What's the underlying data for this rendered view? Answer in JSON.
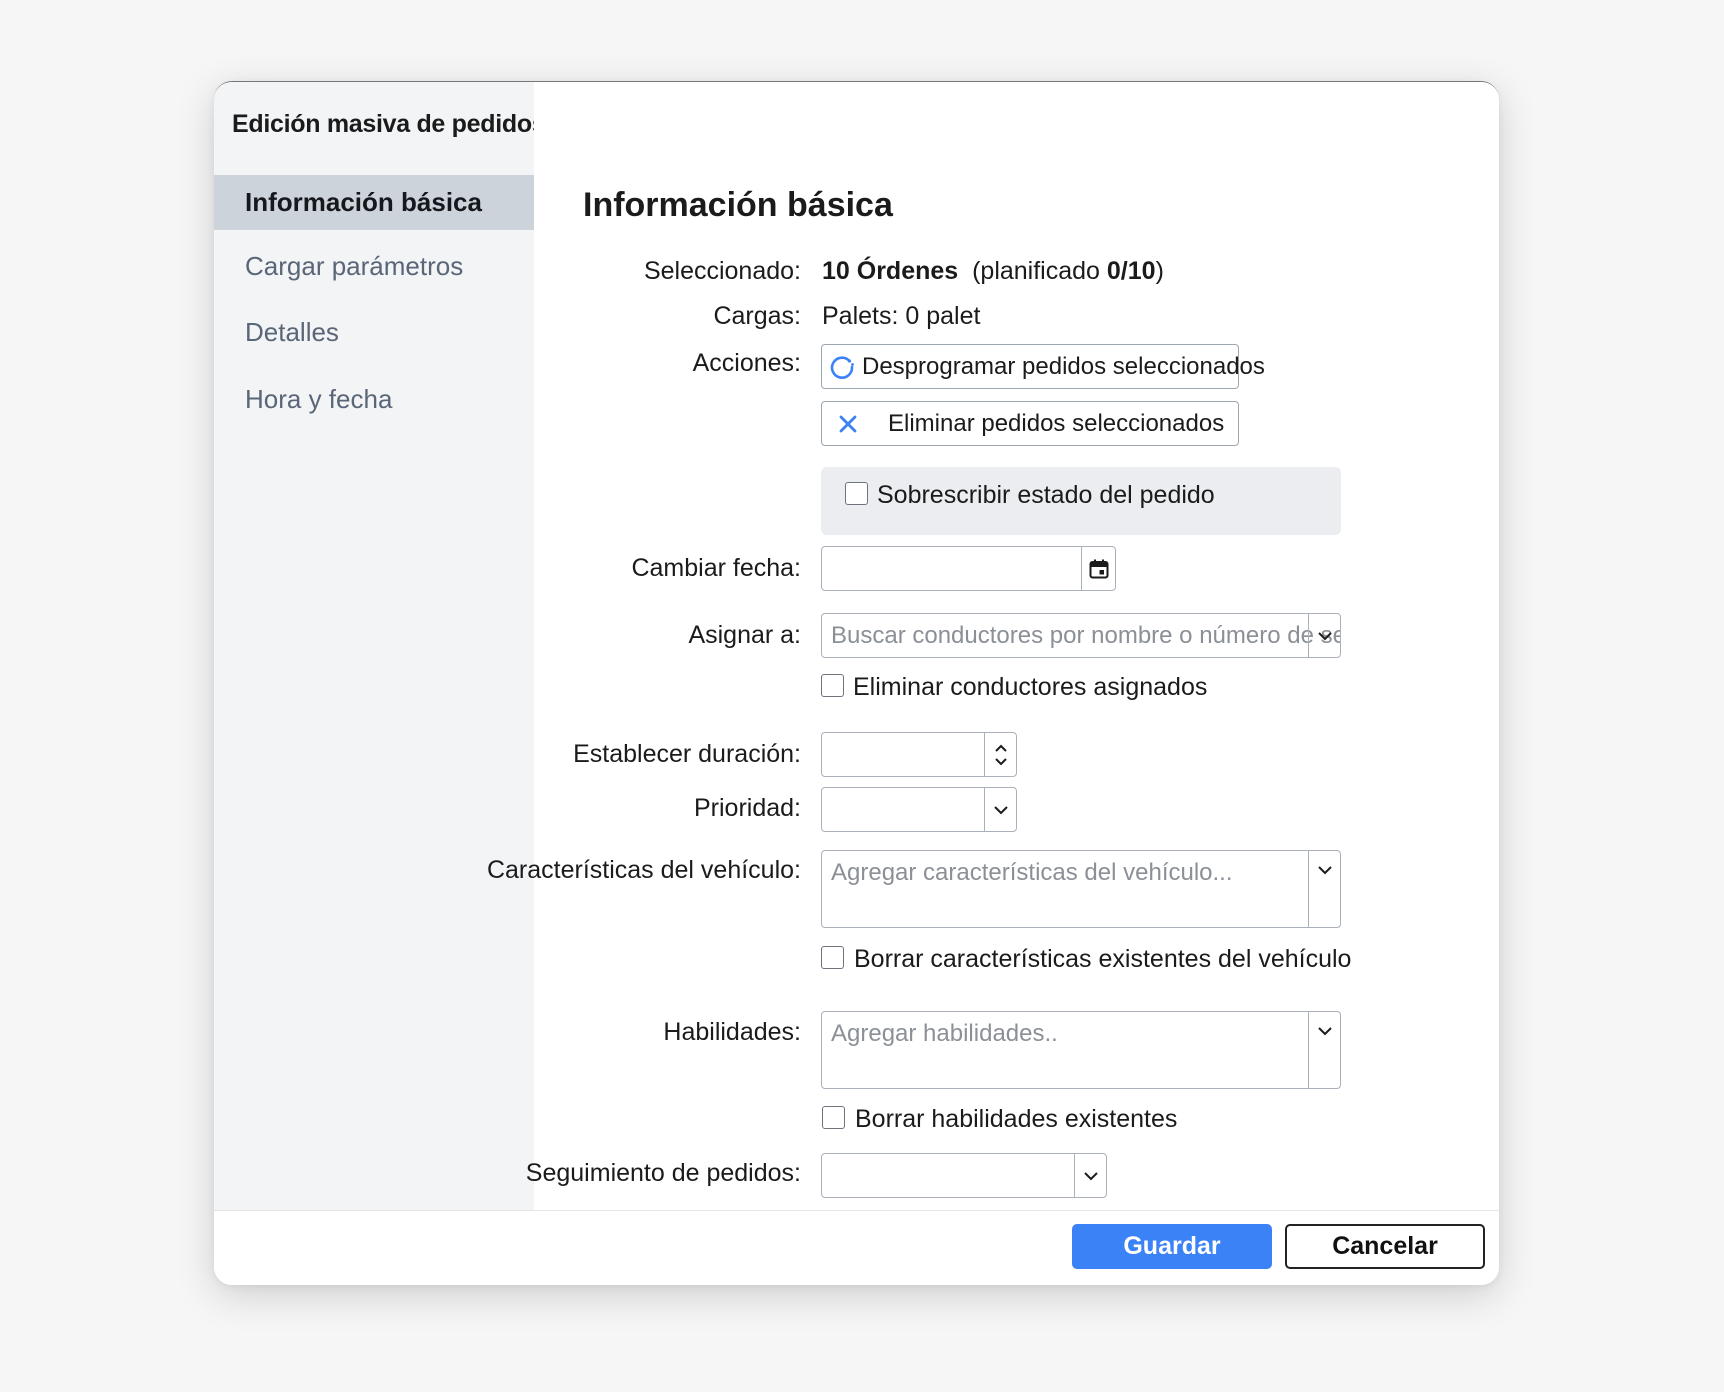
{
  "dialog": {
    "title": "Edición masiva de pedidos"
  },
  "sidebar": {
    "items": [
      {
        "label": "Información básica",
        "active": true
      },
      {
        "label": "Cargar parámetros"
      },
      {
        "label": "Detalles"
      },
      {
        "label": "Hora y fecha"
      }
    ]
  },
  "main": {
    "section_title": "Información básica",
    "selected": {
      "label": "Seleccionado:",
      "count": "10 Órdenes",
      "planned_prefix": "(planificado",
      "planned_value": "0/10",
      "planned_suffix": ")"
    },
    "loads": {
      "label": "Cargas:",
      "value": "Palets: 0 palet"
    },
    "actions": {
      "label": "Acciones:",
      "unschedule": "Desprogramar pedidos seleccionados",
      "delete": "Eliminar pedidos seleccionados",
      "override_status": "Sobrescribir estado del pedido"
    },
    "change_date": {
      "label": "Cambiar fecha:",
      "value": ""
    },
    "assign_to": {
      "label": "Asignar a:",
      "placeholder": "Buscar conductores por nombre o número de serie",
      "remove_drivers": "Eliminar conductores asignados"
    },
    "duration": {
      "label": "Establecer duración:",
      "value": ""
    },
    "priority": {
      "label": "Prioridad:",
      "value": ""
    },
    "vehicle_features": {
      "label": "Características del vehículo:",
      "placeholder": "Agregar características del vehículo...",
      "clear": "Borrar características existentes del vehículo"
    },
    "skills": {
      "label": "Habilidades:",
      "placeholder": "Agregar habilidades..",
      "clear": "Borrar habilidades existentes"
    },
    "tracking": {
      "label": "Seguimiento de pedidos:",
      "value": ""
    }
  },
  "footer": {
    "save_label": "Guardar",
    "cancel_label": "Cancelar"
  },
  "colors": {
    "primary": "#3b82f6",
    "sidebar_bg": "#f3f4f6",
    "sidebar_active": "#cdd3da"
  },
  "icons": {
    "unschedule": "refresh-icon",
    "delete": "close-icon",
    "date": "calendar-icon",
    "dropdown": "chevron-down-icon",
    "stepper": "stepper-icon"
  }
}
